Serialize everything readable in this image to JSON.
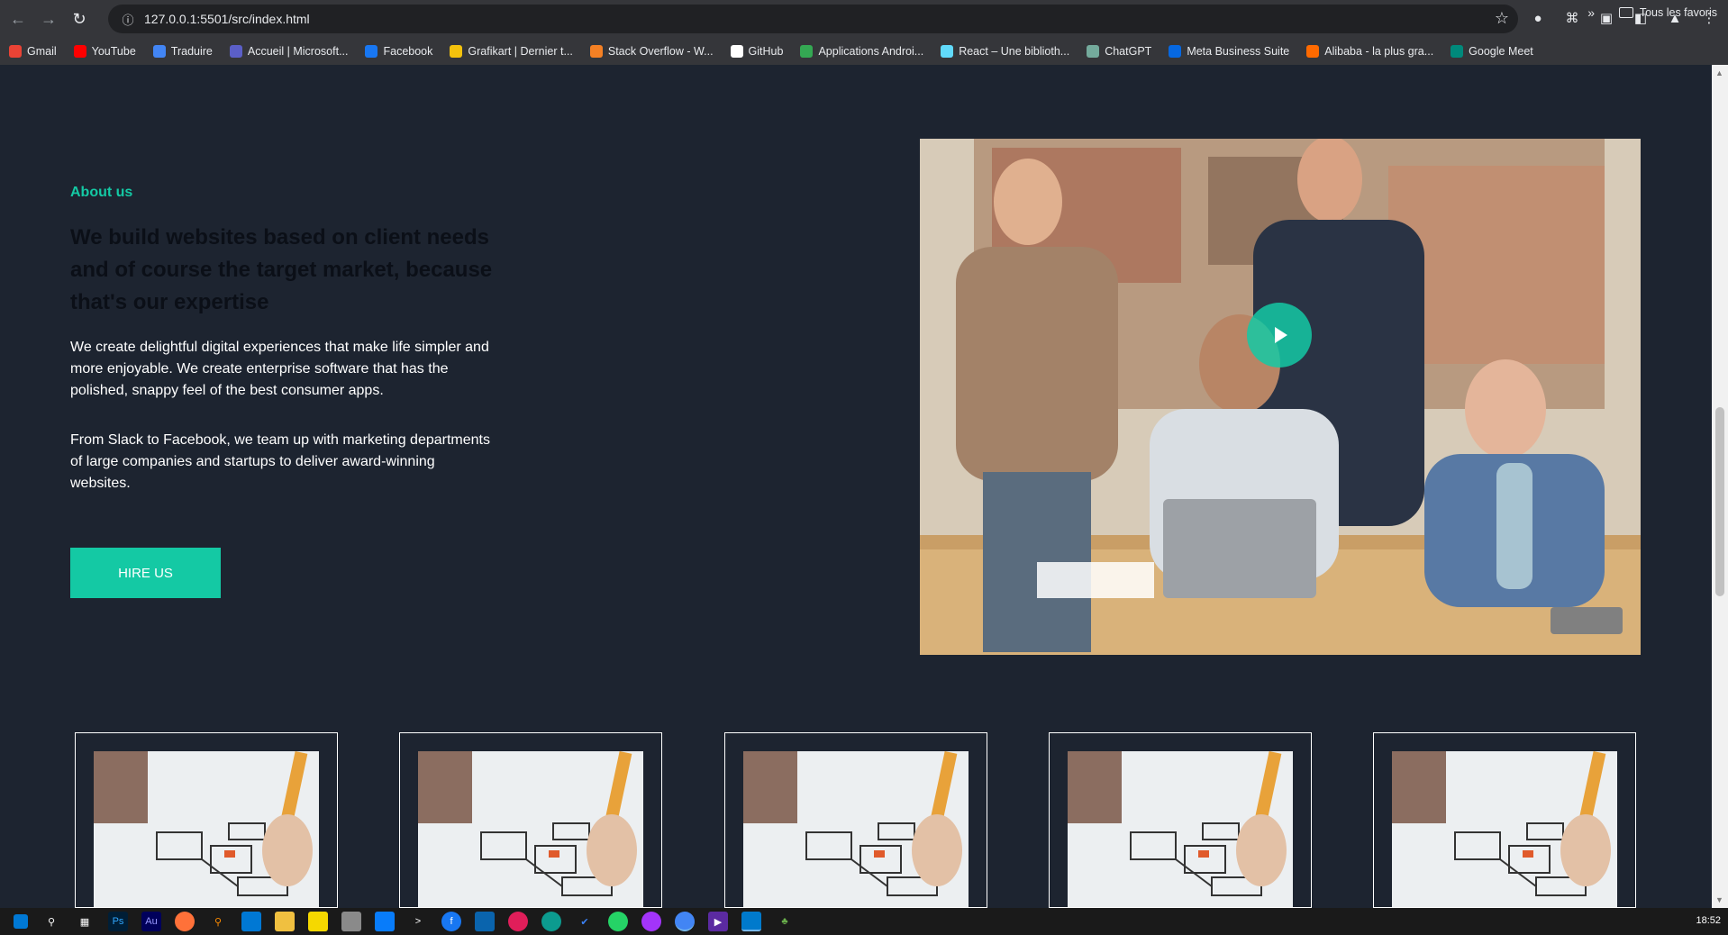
{
  "browser": {
    "url": "127.0.0.1:5501/src/index.html",
    "bookmarks": [
      {
        "label": "Gmail",
        "color": "#ea4335"
      },
      {
        "label": "YouTube",
        "color": "#ff0000"
      },
      {
        "label": "Traduire",
        "color": "#4285f4"
      },
      {
        "label": "Accueil | Microsoft...",
        "color": "#5b5fc7"
      },
      {
        "label": "Facebook",
        "color": "#1877f2"
      },
      {
        "label": "Grafikart | Dernier t...",
        "color": "#f4c20d"
      },
      {
        "label": "Stack Overflow - W...",
        "color": "#f48024"
      },
      {
        "label": "GitHub",
        "color": "#ffffff"
      },
      {
        "label": "Applications Androi...",
        "color": "#34a853"
      },
      {
        "label": "React – Une biblioth...",
        "color": "#61dafb"
      },
      {
        "label": "ChatGPT",
        "color": "#74aa9c"
      },
      {
        "label": "Meta Business Suite",
        "color": "#0668e1"
      },
      {
        "label": "Alibaba - la plus gra...",
        "color": "#ff6a00"
      },
      {
        "label": "Google Meet",
        "color": "#00897b"
      }
    ],
    "other_bookmarks_label": "Tous les favoris"
  },
  "about": {
    "label": "About us",
    "headline": "We build websites based on client needs and of course the target market, because that's our expertise",
    "paragraph1": "We create delightful digital experiences that make life simpler and more enjoyable. We create enterprise software that has the polished, snappy feel of the best consumer apps.",
    "paragraph2": "From Slack to Facebook, we team up with marketing departments of large companies and startups to deliver award-winning websites.",
    "hire_button": "HIRE US"
  },
  "colors": {
    "accent": "#14c9a4",
    "page_background": "#1d2430",
    "headline_text": "#0b0f17"
  },
  "cards": [
    {
      "image": "wireframe-sketch-image"
    },
    {
      "image": "wireframe-sketch-image"
    },
    {
      "image": "wireframe-sketch-image"
    },
    {
      "image": "wireframe-sketch-image"
    },
    {
      "image": "wireframe-sketch-image"
    }
  ],
  "taskbar": {
    "clock": "18:52"
  }
}
